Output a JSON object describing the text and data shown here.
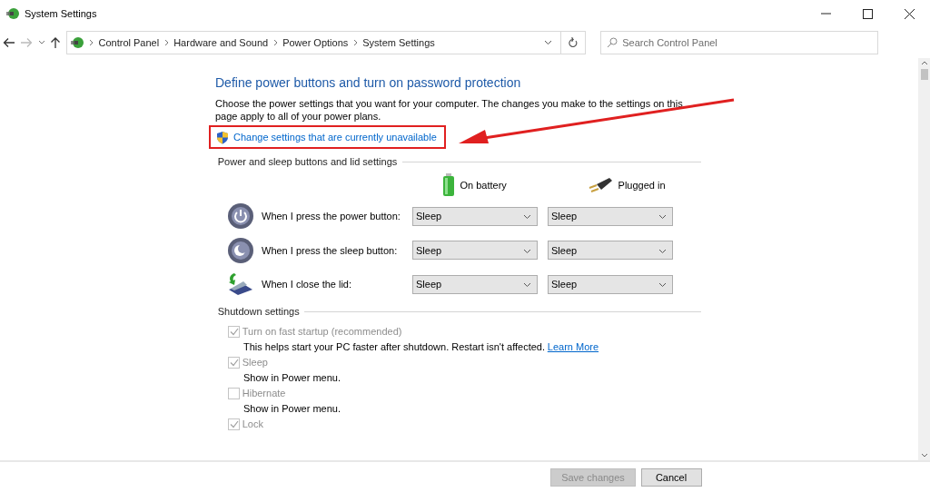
{
  "window": {
    "title": "System Settings"
  },
  "address_bar": {
    "breadcrumbs": [
      "Control Panel",
      "Hardware and Sound",
      "Power Options",
      "System Settings"
    ]
  },
  "search": {
    "placeholder": "Search Control Panel"
  },
  "heading": "Define power buttons and turn on password protection",
  "intro": "Choose the power settings that you want for your computer. The changes you make to the settings on this page apply to all of your power plans.",
  "change_link": "Change settings that are currently unavailable",
  "buttons_section": {
    "title": "Power and sleep buttons and lid settings",
    "columns": [
      {
        "kind": "battery",
        "label": "On battery"
      },
      {
        "kind": "plug",
        "label": "Plugged in"
      }
    ],
    "rows": [
      {
        "kind": "power",
        "label": "When I press the power button:",
        "values": [
          "Sleep",
          "Sleep"
        ]
      },
      {
        "kind": "sleep",
        "label": "When I press the sleep button:",
        "values": [
          "Sleep",
          "Sleep"
        ]
      },
      {
        "kind": "lid",
        "label": "When I close the lid:",
        "values": [
          "Sleep",
          "Sleep"
        ]
      }
    ]
  },
  "shutdown_section": {
    "title": "Shutdown settings",
    "options": [
      {
        "label": "Turn on fast startup (recommended)",
        "checked": true,
        "disabled": true,
        "description": "This helps start your PC faster after shutdown. Restart isn't affected.",
        "link": "Learn More"
      },
      {
        "label": "Sleep",
        "checked": true,
        "disabled": true,
        "description": "Show in Power menu."
      },
      {
        "label": "Hibernate",
        "checked": false,
        "disabled": true,
        "description": "Show in Power menu."
      },
      {
        "label": "Lock",
        "checked": true,
        "disabled": true
      }
    ]
  },
  "footer": {
    "buttons": [
      {
        "label": "Save changes",
        "disabled": true
      },
      {
        "label": "Cancel",
        "disabled": false
      }
    ]
  }
}
